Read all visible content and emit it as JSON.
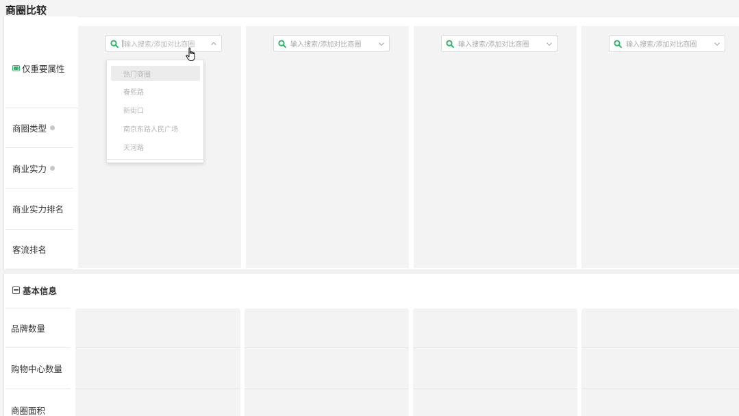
{
  "page": {
    "title": "商圈比较"
  },
  "important_toggle": {
    "label": "仅重要属性"
  },
  "attribute_rows": [
    {
      "label": "商圈类型",
      "has_info": true
    },
    {
      "label": "商业实力",
      "has_info": true
    },
    {
      "label": "商业实力排名",
      "has_info": false
    },
    {
      "label": "客流排名",
      "has_info": false
    }
  ],
  "basic_info": {
    "title": "基本信息",
    "rows": [
      {
        "label": "品牌数量"
      },
      {
        "label": "购物中心数量"
      },
      {
        "label": "商圈面积"
      }
    ]
  },
  "search": {
    "placeholder": "输入搜索/添加对比商圈",
    "boxes": [
      {
        "placeholder": "输入搜索/添加对比商圈",
        "open": true
      },
      {
        "placeholder": "输入搜索/添加对比商圈",
        "open": false
      },
      {
        "placeholder": "输入搜索/添加对比商圈",
        "open": false
      },
      {
        "placeholder": "输入搜索/添加对比商圈",
        "open": false
      }
    ]
  },
  "dropdown": {
    "options": [
      "热门商圈",
      "春熙路",
      "新街口",
      "南京东路人民广场",
      "天河路"
    ],
    "hovered_index": 0
  },
  "colors": {
    "accent": "#2fb56a",
    "column_bg": "#f3f3f3",
    "border": "#e6e6e6"
  },
  "icons": {
    "search": "magnifier-green",
    "chevron_open": "chevron-up",
    "chevron_closed": "chevron-down",
    "toggle": "eye-toggle",
    "collapse": "minus-square",
    "info": "info-dot",
    "cursor": "hand-pointer"
  }
}
